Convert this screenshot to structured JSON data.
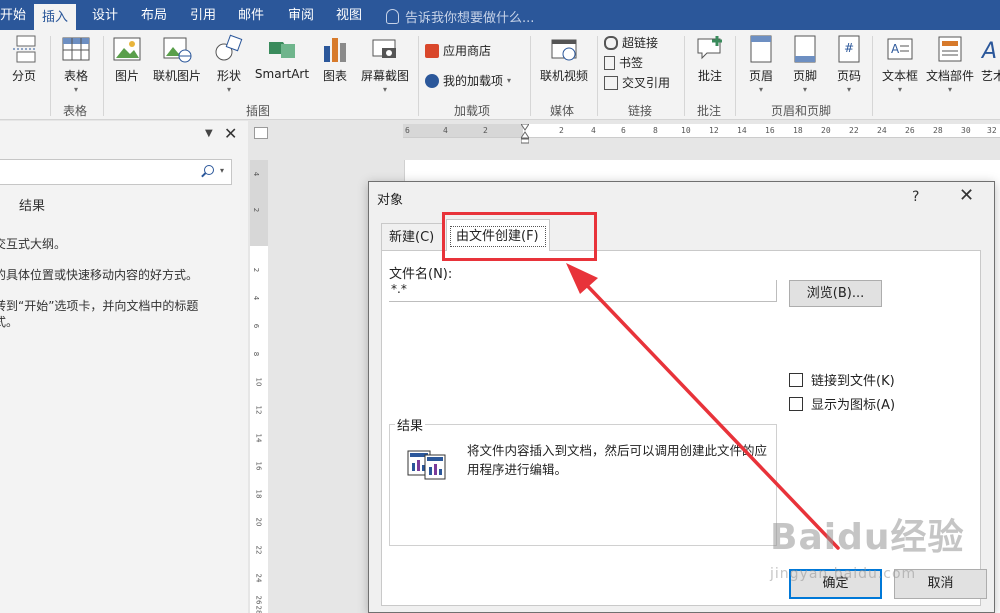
{
  "ribbon": {
    "tabs": [
      "开始",
      "插入",
      "设计",
      "布局",
      "引用",
      "邮件",
      "审阅",
      "视图"
    ],
    "active_tab": "插入",
    "tell_me": "告诉我你想要做什么...",
    "buttons": {
      "page_break": "分页",
      "table": "表格",
      "picture": "图片",
      "online_picture": "联机图片",
      "shapes": "形状",
      "smartart": "SmartArt",
      "chart": "图表",
      "screenshot": "屏幕截图",
      "store": "应用商店",
      "my_addins": "我的加载项",
      "online_video": "联机视频",
      "hyperlink": "超链接",
      "bookmark": "书签",
      "cross_reference": "交叉引用",
      "comment": "批注",
      "header": "页眉",
      "footer": "页脚",
      "page_number": "页码",
      "textbox": "文本框",
      "quick_parts": "文档部件",
      "wordart": "艺术"
    },
    "groups": {
      "tables": "表格",
      "illustrations": "插图",
      "addins": "加载项",
      "media": "媒体",
      "links": "链接",
      "comments": "批注",
      "header_footer": "页眉和页脚"
    }
  },
  "nav_pane": {
    "results_tab": "结果",
    "lines": [
      "交互式大纲。",
      "的具体位置或快速移动内容的好方式。",
      "转到“开始”选项卡，并向文档中的标题",
      "式。"
    ]
  },
  "ruler": {
    "h_ticks": [
      "6",
      "4",
      "2",
      "2",
      "4",
      "6",
      "8",
      "10",
      "12",
      "14",
      "16",
      "18",
      "20",
      "22",
      "24",
      "26",
      "28",
      "30",
      "32"
    ],
    "v_ticks": [
      "4",
      "2",
      "2",
      "4",
      "6",
      "8",
      "10",
      "12",
      "14",
      "16",
      "18",
      "20",
      "22",
      "24",
      "26",
      "28"
    ]
  },
  "dialog": {
    "title": "对象",
    "help": "?",
    "close": "✕",
    "tab_new": "新建(C)",
    "tab_from_file": "由文件创建(F)",
    "filename_label": "文件名(N):",
    "filename_value": "*.*",
    "browse": "浏览(B)...",
    "link_to_file": "链接到文件(K)",
    "display_as_icon": "显示为图标(A)",
    "result_label": "结果",
    "result_text": "将文件内容插入到文档，然后可以调用创建此文件的应用程序进行编辑。",
    "ok": "确定",
    "cancel": "取消"
  },
  "watermark": {
    "main": "Baidu经验",
    "sub": "jingyan.baidu.com"
  },
  "colors": {
    "ribbon_blue": "#2b579a",
    "annotation_red": "#e8333a",
    "focus_blue": "#0078d7"
  }
}
